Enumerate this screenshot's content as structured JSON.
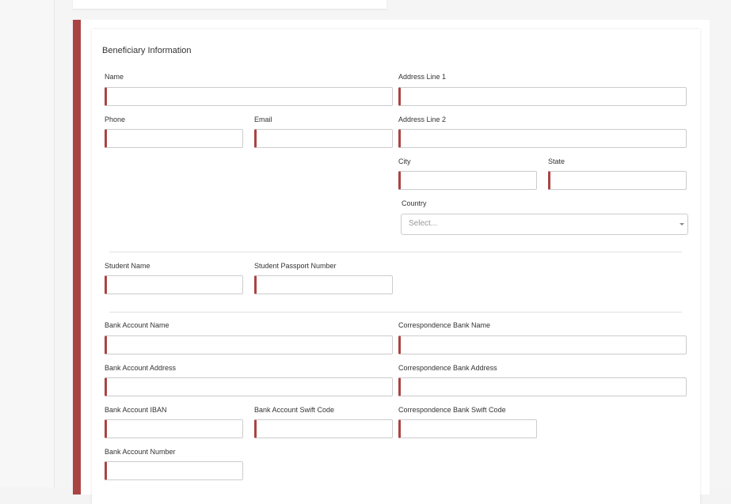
{
  "form": {
    "title": "Beneficiary Information",
    "labels": {
      "name": "Name",
      "phone": "Phone",
      "email": "Email",
      "address1": "Address Line 1",
      "address2": "Address Line 2",
      "city": "City",
      "state": "State",
      "country": "Country",
      "student_name": "Student Name",
      "student_passport": "Student Passport Number",
      "bank_account_name": "Bank Account Name",
      "bank_account_address": "Bank Account Address",
      "bank_account_iban": "Bank Account IBAN",
      "bank_account_swift": "Bank Account Swift Code",
      "bank_account_number": "Bank Account Number",
      "corr_bank_name": "Correspondence Bank Name",
      "corr_bank_address": "Correspondence Bank Address",
      "corr_bank_swift": "Correspondence Bank Swift Code"
    },
    "country_placeholder": "Select...",
    "colors": {
      "accent": "#a94442",
      "border": "#cccccc"
    }
  }
}
